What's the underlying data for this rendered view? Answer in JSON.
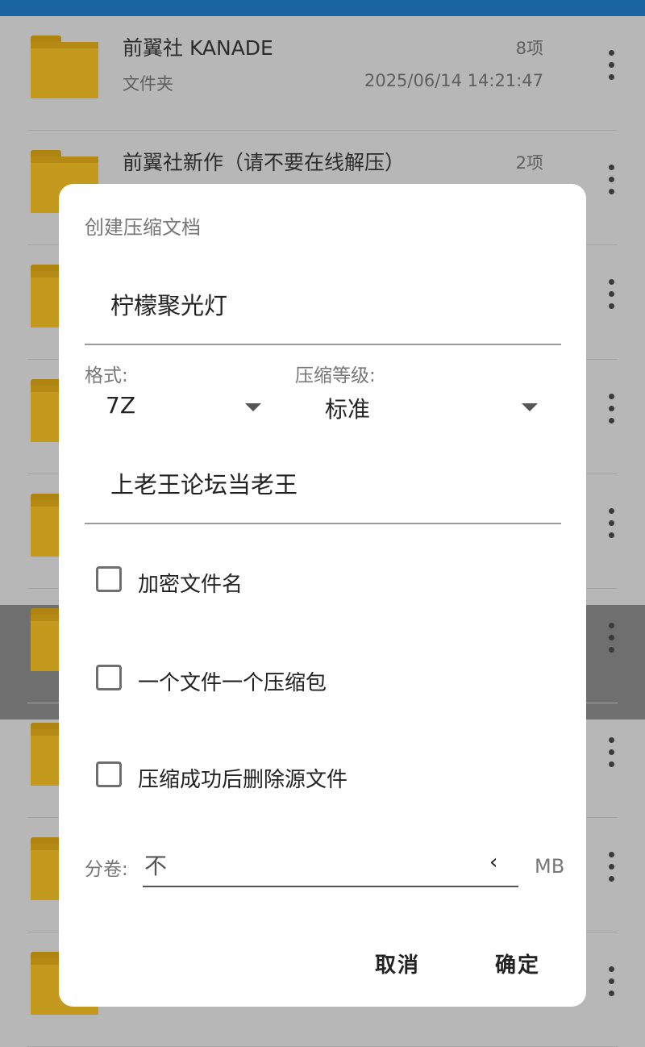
{
  "files": [
    {
      "name": "前翼社 KANADE",
      "type": "文件夹",
      "count": "8项",
      "date": "2025/06/14 14:21:47"
    },
    {
      "name": "前翼社新作（请不要在线解压）",
      "count": "2项"
    }
  ],
  "dialog": {
    "title": "创建压缩文档",
    "archive_name": "柠檬聚光灯",
    "format_label": "格式:",
    "format_value": "7Z",
    "level_label": "压缩等级:",
    "level_value": "标准",
    "password": "上老王论坛当老王",
    "options": [
      {
        "label": "加密文件名",
        "checked": false
      },
      {
        "label": "一个文件一个压缩包",
        "checked": false
      },
      {
        "label": "压缩成功后删除源文件",
        "checked": false
      }
    ],
    "split_label": "分卷:",
    "split_value": "不",
    "split_unit": "MB",
    "cancel_label": "取消",
    "ok_label": "确定"
  },
  "colors": {
    "statusbar": "#1c65a3",
    "folder": "#c39a1e",
    "scrim": "#b7b7b7"
  }
}
